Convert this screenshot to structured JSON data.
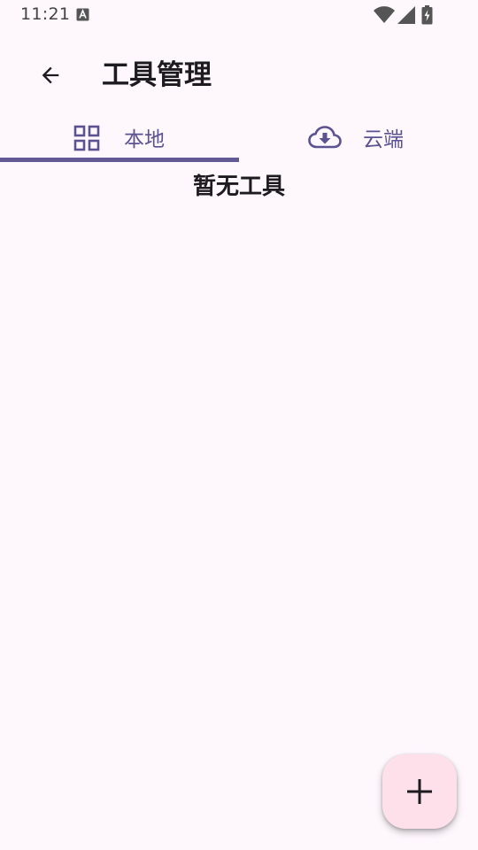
{
  "status_bar": {
    "time": "11:21",
    "icons": [
      "notification-a-icon",
      "wifi-icon",
      "signal-icon",
      "battery-charging-icon"
    ]
  },
  "app_bar": {
    "back_icon": "arrow-back-icon",
    "title": "工具管理"
  },
  "tabs": [
    {
      "label": "本地",
      "icon": "grid-icon",
      "selected": true
    },
    {
      "label": "云端",
      "icon": "cloud-download-icon",
      "selected": false
    }
  ],
  "main": {
    "empty_text": "暂无工具"
  },
  "fab": {
    "icon": "plus-icon"
  },
  "colors": {
    "background": "#fef7fc",
    "accent": "#625a95",
    "tab_text": "#5b5291",
    "fab_background": "#fde0ea",
    "text": "#1d1b20"
  }
}
